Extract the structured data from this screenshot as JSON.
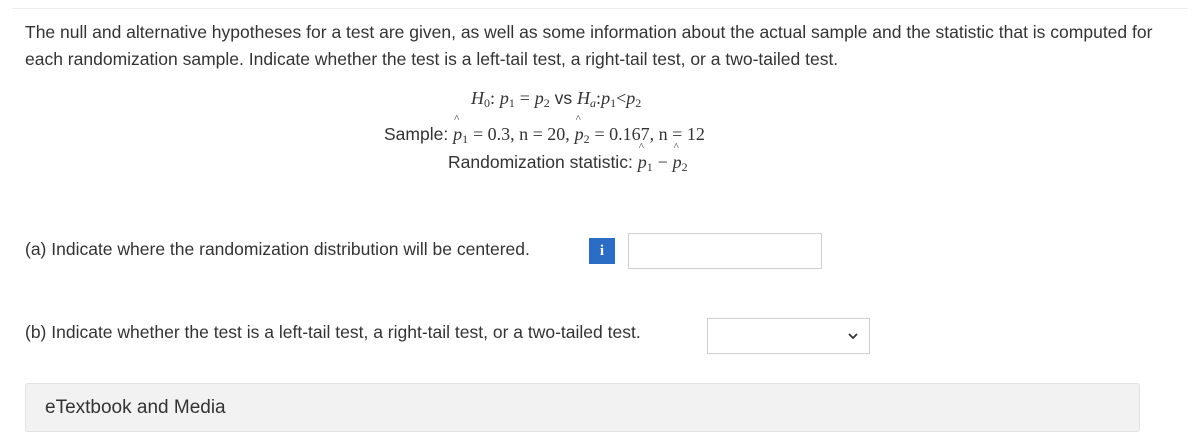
{
  "question": {
    "intro": "The null and alternative hypotheses for a test are given, as well as some information about the actual sample and the statistic that is computed for each randomization sample. Indicate whether the test is a left-tail test, a right-tail test, or a two-tailed test.",
    "hypotheses": {
      "h0_symbol": "H",
      "h0_sub": "0",
      "colon": ":",
      "p": "p",
      "sub1": "1",
      "sub2": "2",
      "equals": "=",
      "vs": "vs",
      "ha_symbol": "H",
      "ha_sub": "a",
      "less_than": "<"
    },
    "sample": {
      "label": "Sample:",
      "n1_part": "= 0.3, n = 20,",
      "n2_part": "= 0.167, n = 12"
    },
    "statistic": {
      "label": "Randomization statistic:",
      "minus": "−"
    }
  },
  "part_a": {
    "label": "(a) Indicate where the randomization distribution will be centered.",
    "info_icon_glyph": "i",
    "input_value": ""
  },
  "part_b": {
    "label": "(b) Indicate whether the test is a left-tail test, a right-tail test, or a two-tailed test.",
    "selected_value": ""
  },
  "resources": {
    "label": "eTextbook and Media"
  },
  "colors": {
    "info_button": "#2b6cc4",
    "text": "#333333",
    "panel_bg": "#f2f2f2"
  }
}
